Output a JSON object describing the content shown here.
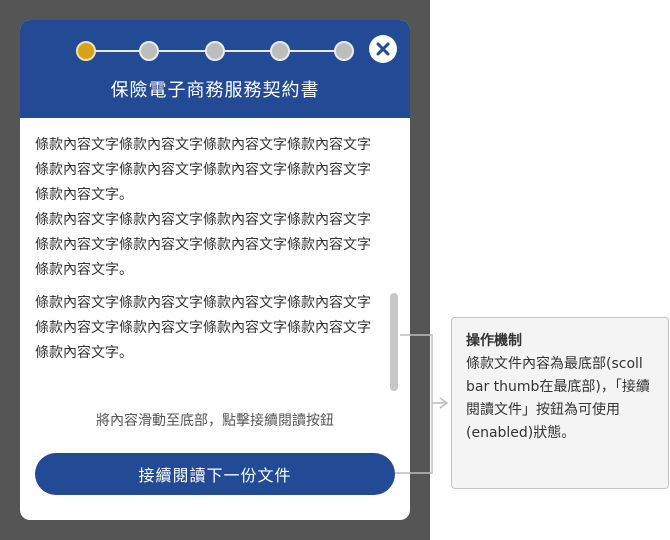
{
  "modal": {
    "title": "保險電子商務服務契約書",
    "steps": [
      {
        "state": "active"
      },
      {
        "state": "inactive"
      },
      {
        "state": "inactive"
      },
      {
        "state": "inactive"
      },
      {
        "state": "inactive"
      }
    ],
    "paragraphs": [
      "條款內容文字條款內容文字條款內容文字條款內容文字條款內容文字條款內容文字條款內容文字條款內容文字條款內容文字。",
      "條款內容文字條款內容文字條款內容文字條款內容文字條款內容文字條款內容文字條款內容文字條款內容文字條款內容文字。",
      "條款內容文字條款內容文字條款內容文字條款內容文字條款內容文字條款內容文字條款內容文字條款內容文字條款內容文字。"
    ],
    "hint": "將內容滑動至底部，點擊接續閱讀按鈕",
    "next_button": "接續閱讀下一份文件",
    "scroll_position": 1.0
  },
  "annotation": {
    "title": "操作機制",
    "body": "條款文件內容為最底部(scoll bar thumb在最底部)，「接續閱讀文件」按鈕為可使用(enabled)狀態。"
  },
  "colors": {
    "header": "#234a94",
    "active_step": "#d9a21b",
    "inactive_step": "#bdbdbd",
    "backdrop": "#555555"
  }
}
